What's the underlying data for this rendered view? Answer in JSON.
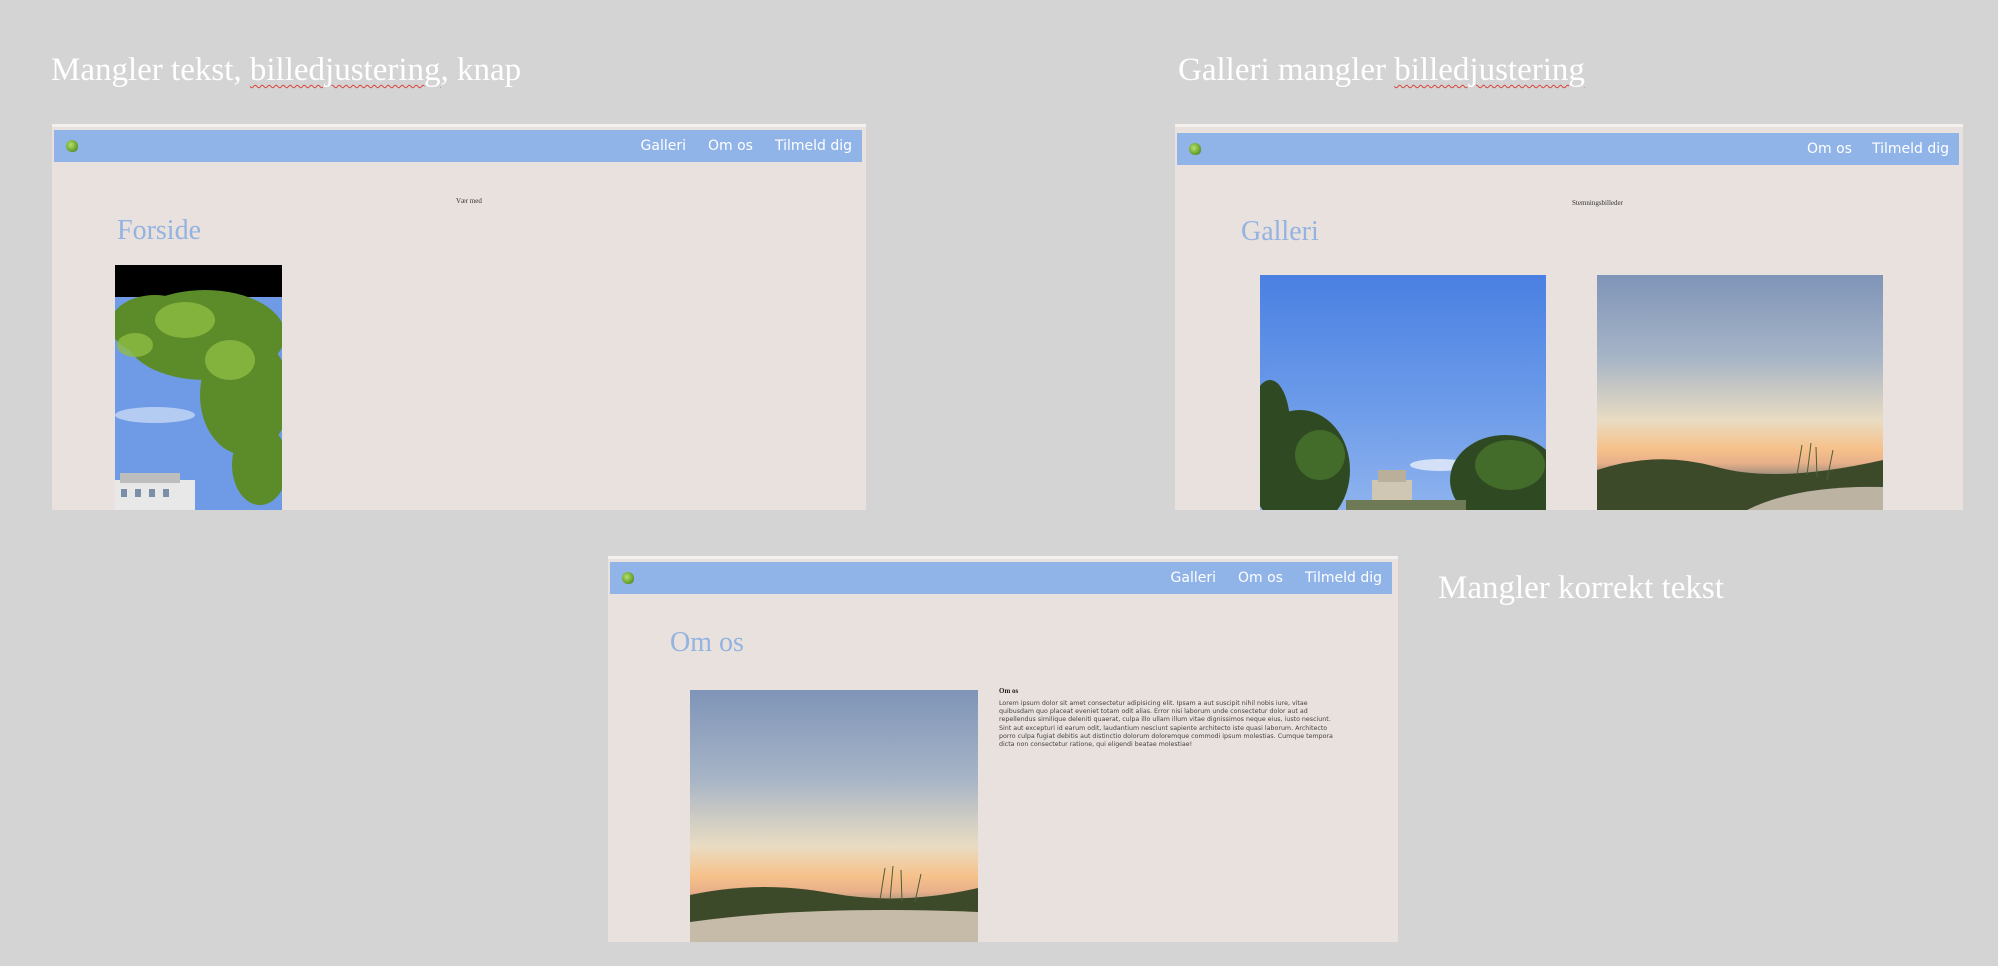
{
  "captions": {
    "frontpage_prefix": "Mangler tekst, ",
    "frontpage_squiggle": "billedjustering",
    "frontpage_suffix": ", knap",
    "gallery_prefix": "Galleri mangler ",
    "gallery_squiggle": "billedjustering",
    "about": "Mangler korrekt tekst"
  },
  "nav": {
    "galleri": "Galleri",
    "om_os": "Om os",
    "tilmeld": "Tilmeld dig"
  },
  "frontpage": {
    "title": "Forside",
    "small_text": "Vær med"
  },
  "gallery": {
    "title": "Galleri",
    "small_text": "Stemningsbilleder"
  },
  "about": {
    "title": "Om os",
    "heading": "Om os",
    "body": "Lorem ipsum dolor sit amet consectetur adipisicing elit. Ipsam a aut suscipit nihil nobis iure, vitae quibusdam quo placeat eveniet totam odit alias. Error nisi laborum unde consectetur dolor aut ad repellendus similique deleniti quaerat, culpa illo ullam illum vitae dignissimos neque eius, iusto nesciunt. Sint aut excepturi id earum odit, laudantium nesciunt sapiente architecto iste quasi laborum. Architecto porro culpa fugiat debitis aut distinctio dolorum doloremque commodi ipsum molestias. Cumque tempora dicta non consectetur ratione, qui eligendi beatae molestiae!"
  },
  "colors": {
    "background": "#d4d4d4",
    "navbar": "#90b4e7",
    "page_bg": "#e9e1de",
    "title_color": "#94b3e0"
  }
}
